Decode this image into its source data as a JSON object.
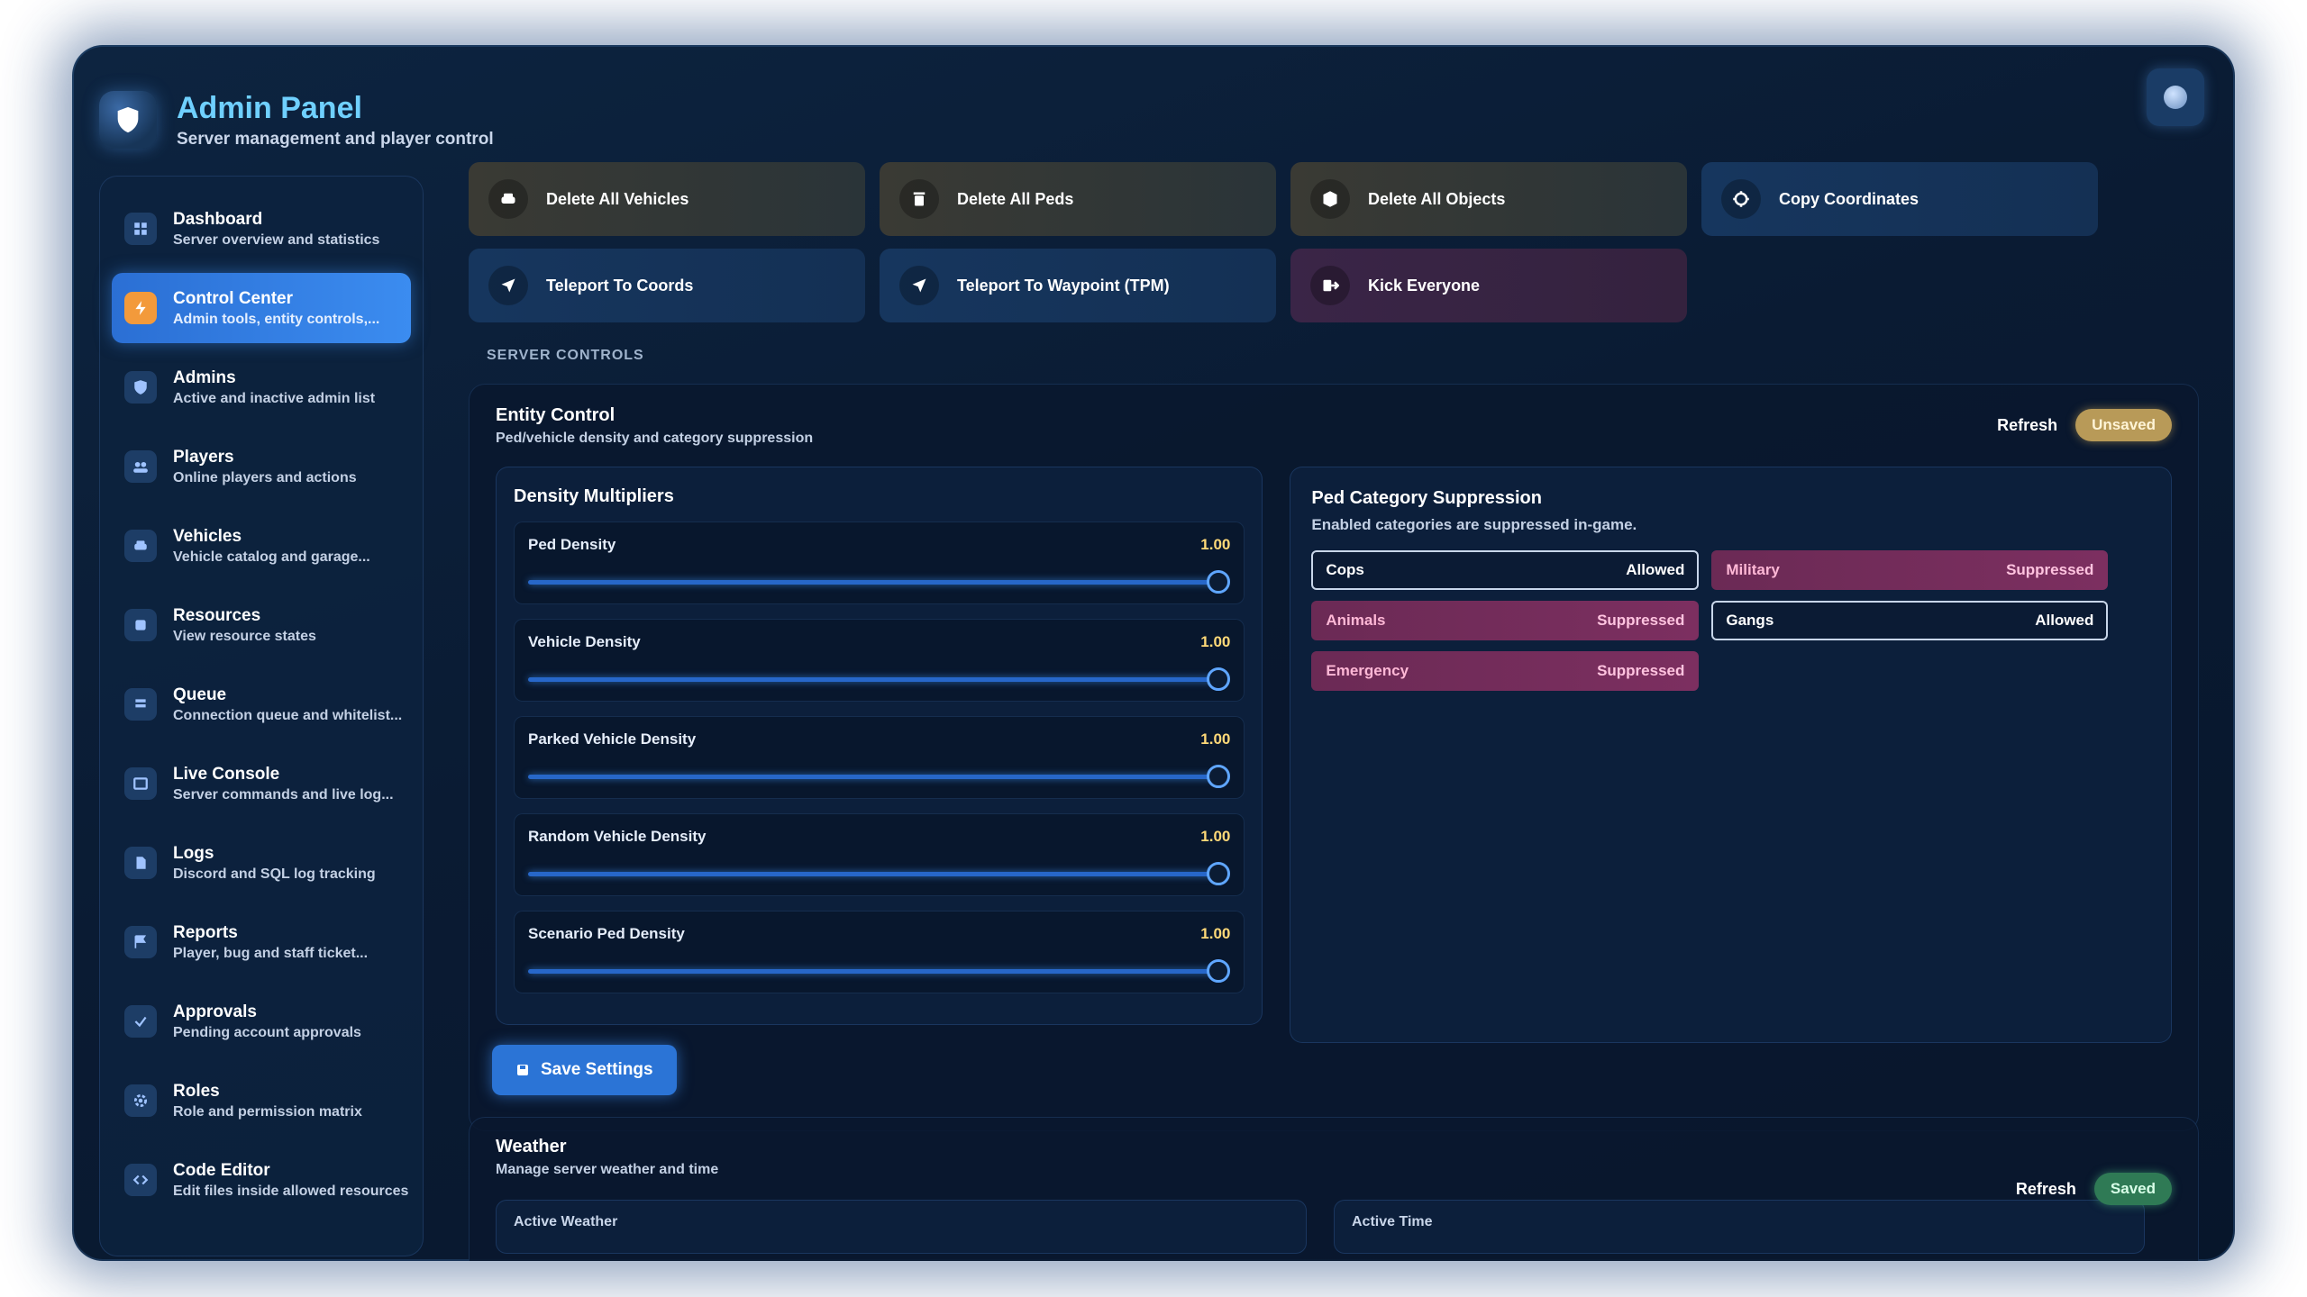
{
  "header": {
    "title": "Admin Panel",
    "subtitle": "Server management and player control"
  },
  "sidebar": {
    "items": [
      {
        "label": "Dashboard",
        "desc": "Server overview and statistics",
        "icon": "grid-icon"
      },
      {
        "label": "Control Center",
        "desc": "Admin tools, entity controls,...",
        "icon": "bolt-icon"
      },
      {
        "label": "Admins",
        "desc": "Active and inactive admin list",
        "icon": "shield-icon"
      },
      {
        "label": "Players",
        "desc": "Online players and actions",
        "icon": "users-icon"
      },
      {
        "label": "Vehicles",
        "desc": "Vehicle catalog and garage...",
        "icon": "car-icon"
      },
      {
        "label": "Resources",
        "desc": "View resource states",
        "icon": "box-icon"
      },
      {
        "label": "Queue",
        "desc": "Connection queue and whitelist...",
        "icon": "queue-icon"
      },
      {
        "label": "Live Console",
        "desc": "Server commands and live log...",
        "icon": "terminal-icon"
      },
      {
        "label": "Logs",
        "desc": "Discord and SQL log tracking",
        "icon": "file-icon"
      },
      {
        "label": "Reports",
        "desc": "Player, bug and staff ticket...",
        "icon": "flag-icon"
      },
      {
        "label": "Approvals",
        "desc": "Pending account approvals",
        "icon": "check-icon"
      },
      {
        "label": "Roles",
        "desc": "Role and permission matrix",
        "icon": "gear-icon"
      },
      {
        "label": "Code Editor",
        "desc": "Edit files inside allowed resources",
        "icon": "code-icon"
      }
    ],
    "active_index": 1
  },
  "actions": [
    {
      "label": "Delete All Vehicles",
      "icon": "car-icon",
      "style": "danger"
    },
    {
      "label": "Delete All Peds",
      "icon": "trash-icon",
      "style": "danger"
    },
    {
      "label": "Delete All Objects",
      "icon": "cube-icon",
      "style": "danger"
    },
    {
      "label": "Copy Coordinates",
      "icon": "crosshair-icon",
      "style": "blue"
    },
    {
      "label": "Teleport To Coords",
      "icon": "navigate-icon",
      "style": "blue"
    },
    {
      "label": "Teleport To Waypoint (TPM)",
      "icon": "navigate-icon",
      "style": "blue"
    },
    {
      "label": "Kick Everyone",
      "icon": "logout-icon",
      "style": "red"
    }
  ],
  "section_label": "SERVER CONTROLS",
  "entity_control": {
    "title": "Entity Control",
    "subtitle": "Ped/vehicle density and category suppression",
    "refresh_label": "Refresh",
    "status": "Unsaved",
    "density": {
      "title": "Density Multipliers",
      "sliders": [
        {
          "label": "Ped Density",
          "value": "1.00"
        },
        {
          "label": "Vehicle Density",
          "value": "1.00"
        },
        {
          "label": "Parked Vehicle Density",
          "value": "1.00"
        },
        {
          "label": "Random Vehicle Density",
          "value": "1.00"
        },
        {
          "label": "Scenario Ped Density",
          "value": "1.00"
        }
      ]
    },
    "suppression": {
      "title": "Ped Category Suppression",
      "subtitle": "Enabled categories are suppressed in-game.",
      "categories": [
        {
          "name": "Cops",
          "state": "Allowed"
        },
        {
          "name": "Military",
          "state": "Suppressed"
        },
        {
          "name": "Animals",
          "state": "Suppressed"
        },
        {
          "name": "Gangs",
          "state": "Allowed"
        },
        {
          "name": "Emergency",
          "state": "Suppressed"
        }
      ]
    },
    "save_label": "Save Settings"
  },
  "weather": {
    "title": "Weather",
    "subtitle": "Manage server weather and time",
    "refresh_label": "Refresh",
    "status": "Saved",
    "active_weather_label": "Active Weather",
    "active_time_label": "Active Time"
  }
}
